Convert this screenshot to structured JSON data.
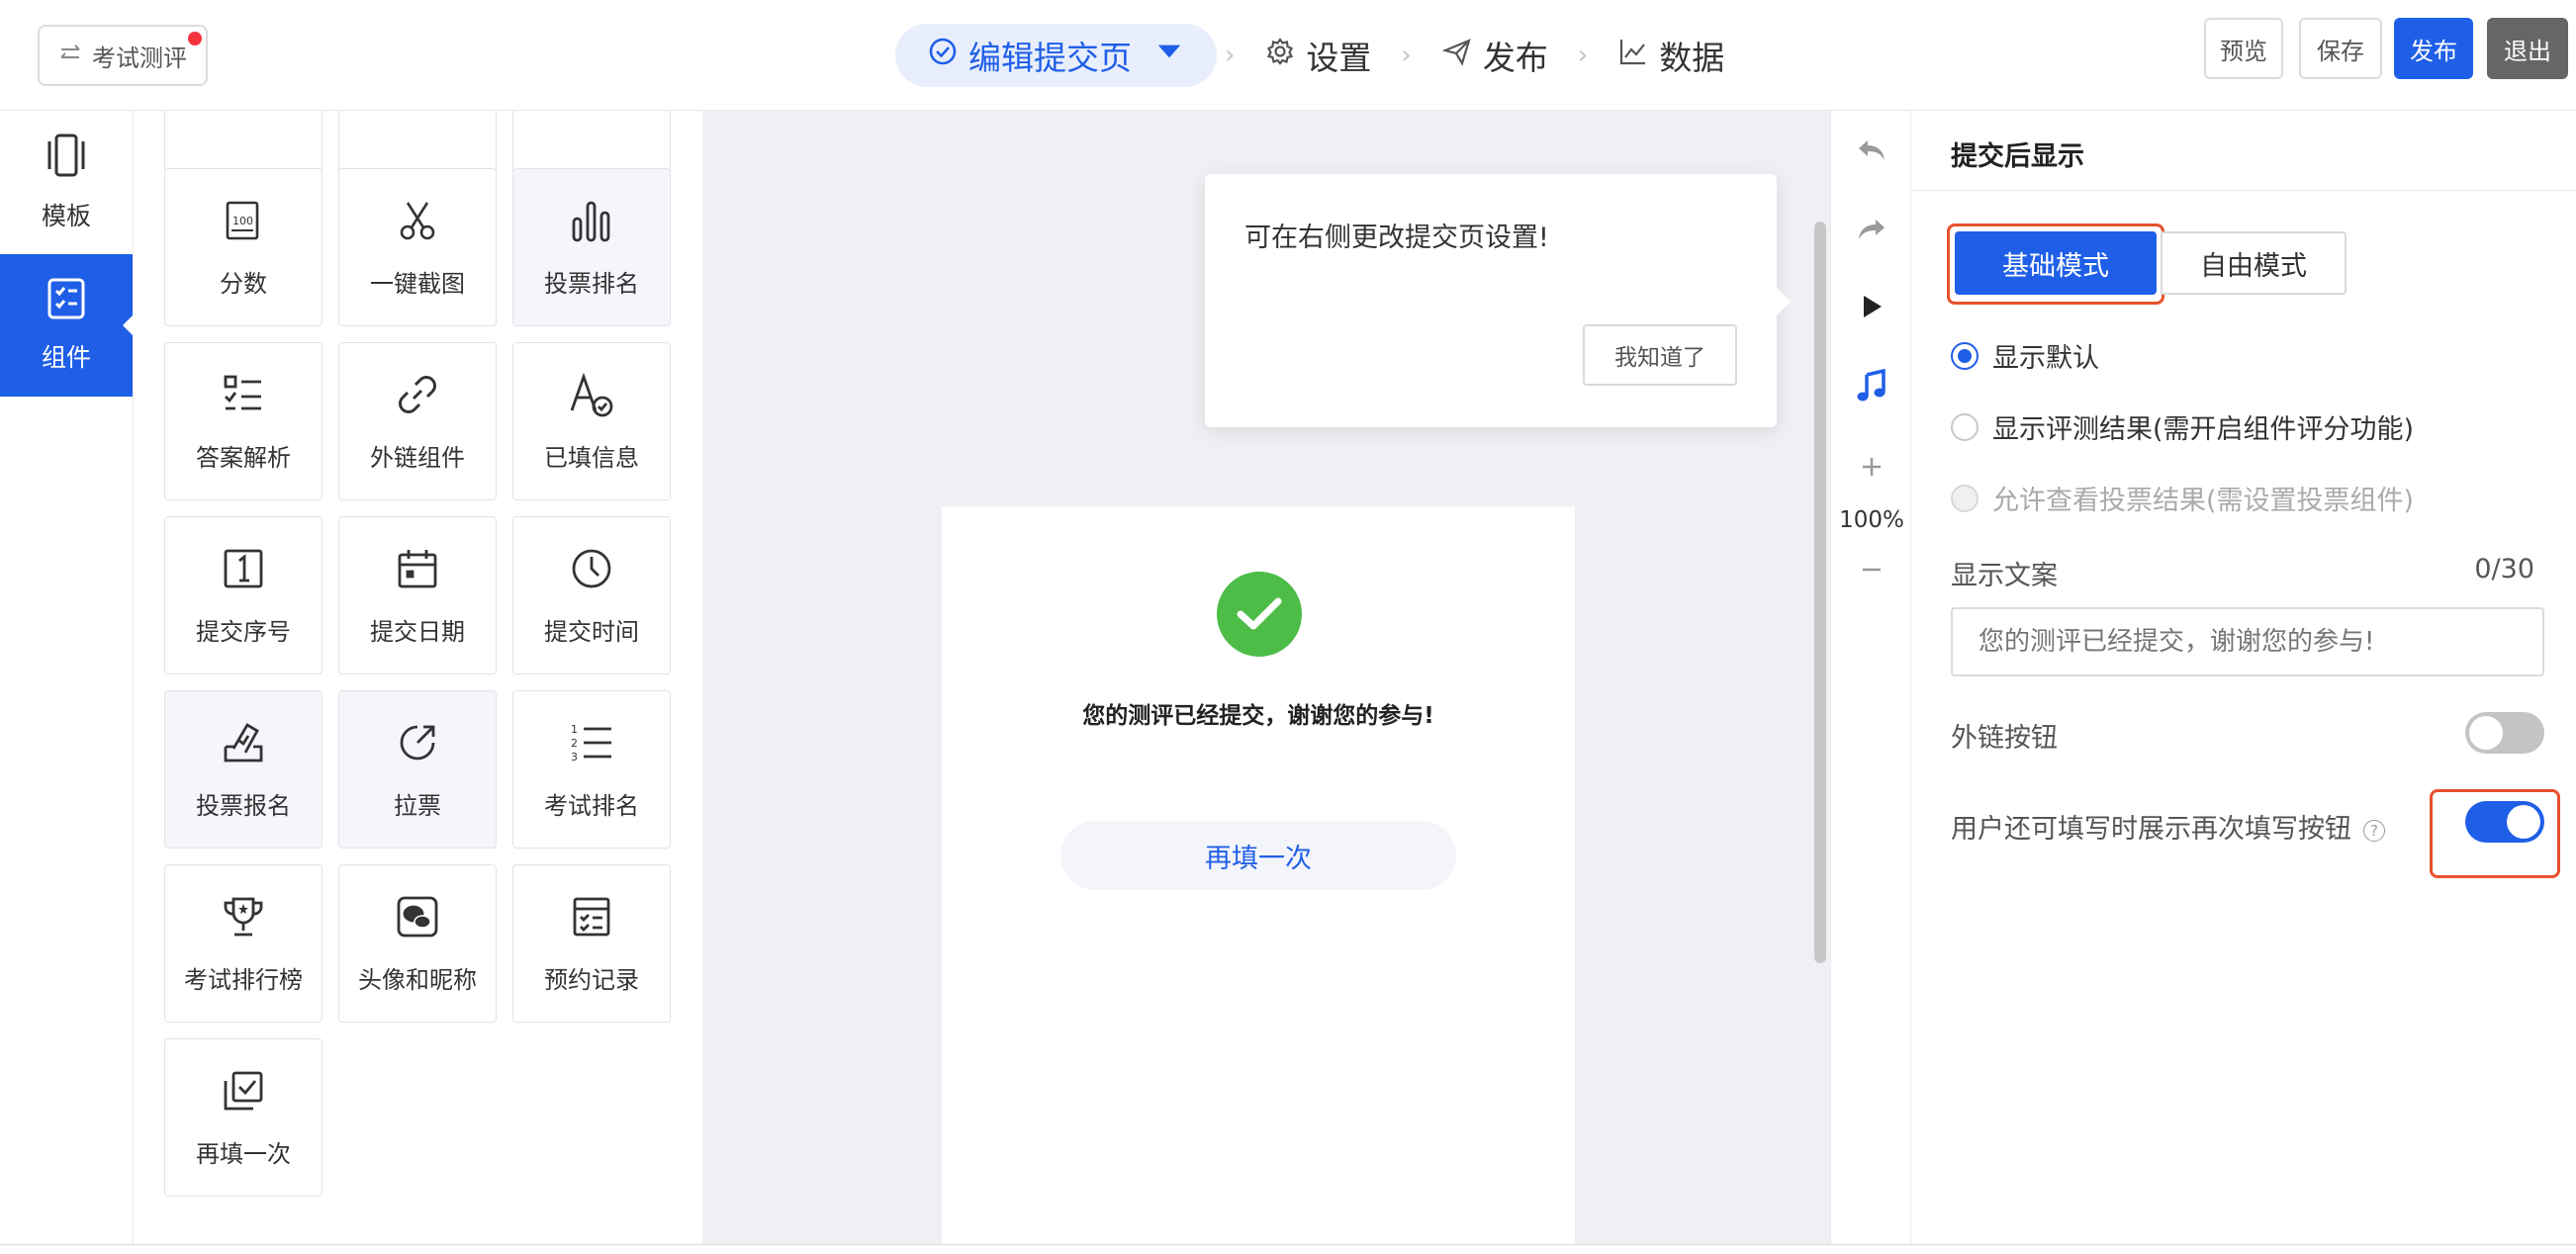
{
  "header": {
    "back_label": "考试测评",
    "steps": [
      {
        "label": "编辑提交页",
        "icon": "check-circle-icon"
      },
      {
        "label": "设置",
        "icon": "gear-icon"
      },
      {
        "label": "发布",
        "icon": "paper-plane-icon"
      },
      {
        "label": "数据",
        "icon": "line-chart-icon"
      }
    ],
    "buttons": {
      "preview": "预览",
      "save": "保存",
      "publish": "发布",
      "exit": "退出"
    },
    "accent": "#1f5fe8"
  },
  "leftnav": {
    "items": [
      {
        "label": "模板",
        "icon": "phone-template-icon"
      },
      {
        "label": "组件",
        "icon": "component-icon"
      }
    ],
    "active_index": 1
  },
  "components": {
    "tiles": [
      {
        "label": "分数",
        "icon": "score-100-icon"
      },
      {
        "label": "一键截图",
        "icon": "scissors-icon"
      },
      {
        "label": "投票排名",
        "icon": "bar-ranking-icon"
      },
      {
        "label": "答案解析",
        "icon": "checklist-icon"
      },
      {
        "label": "外链组件",
        "icon": "link-icon"
      },
      {
        "label": "已填信息",
        "icon": "filled-info-icon"
      },
      {
        "label": "提交序号",
        "icon": "number-one-icon"
      },
      {
        "label": "提交日期",
        "icon": "calendar-icon"
      },
      {
        "label": "提交时间",
        "icon": "clock-icon"
      },
      {
        "label": "投票报名",
        "icon": "ballot-box-icon"
      },
      {
        "label": "拉票",
        "icon": "share-arrow-icon"
      },
      {
        "label": "考试排名",
        "icon": "ordered-list-icon"
      },
      {
        "label": "考试排行榜",
        "icon": "trophy-icon"
      },
      {
        "label": "头像和昵称",
        "icon": "wechat-avatar-icon"
      },
      {
        "label": "预约记录",
        "icon": "appointment-icon"
      },
      {
        "label": "再填一次",
        "icon": "refill-icon"
      }
    ]
  },
  "canvas": {
    "popover": {
      "message": "可在右侧更改提交页设置!",
      "ok_label": "我知道了"
    },
    "preview": {
      "message": "您的测评已经提交，谢谢您的参与!",
      "refill_label": "再填一次"
    }
  },
  "tools": {
    "zoom": "100%"
  },
  "settings": {
    "title": "提交后显示",
    "modes": {
      "basic": "基础模式",
      "free": "自由模式"
    },
    "radios": [
      {
        "label": "显示默认",
        "checked": true,
        "disabled": false
      },
      {
        "label": "显示评测结果(需开启组件评分功能)",
        "checked": false,
        "disabled": false
      },
      {
        "label": "允许查看投票结果(需设置投票组件)",
        "checked": false,
        "disabled": true
      }
    ],
    "text_label": "显示文案",
    "text_count": "0/30",
    "text_placeholder": "您的测评已经提交，谢谢您的参与!",
    "external_button_label": "外链按钮",
    "external_button_on": false,
    "refill_toggle_label": "用户还可填写时展示再次填写按钮",
    "refill_toggle_on": true
  }
}
